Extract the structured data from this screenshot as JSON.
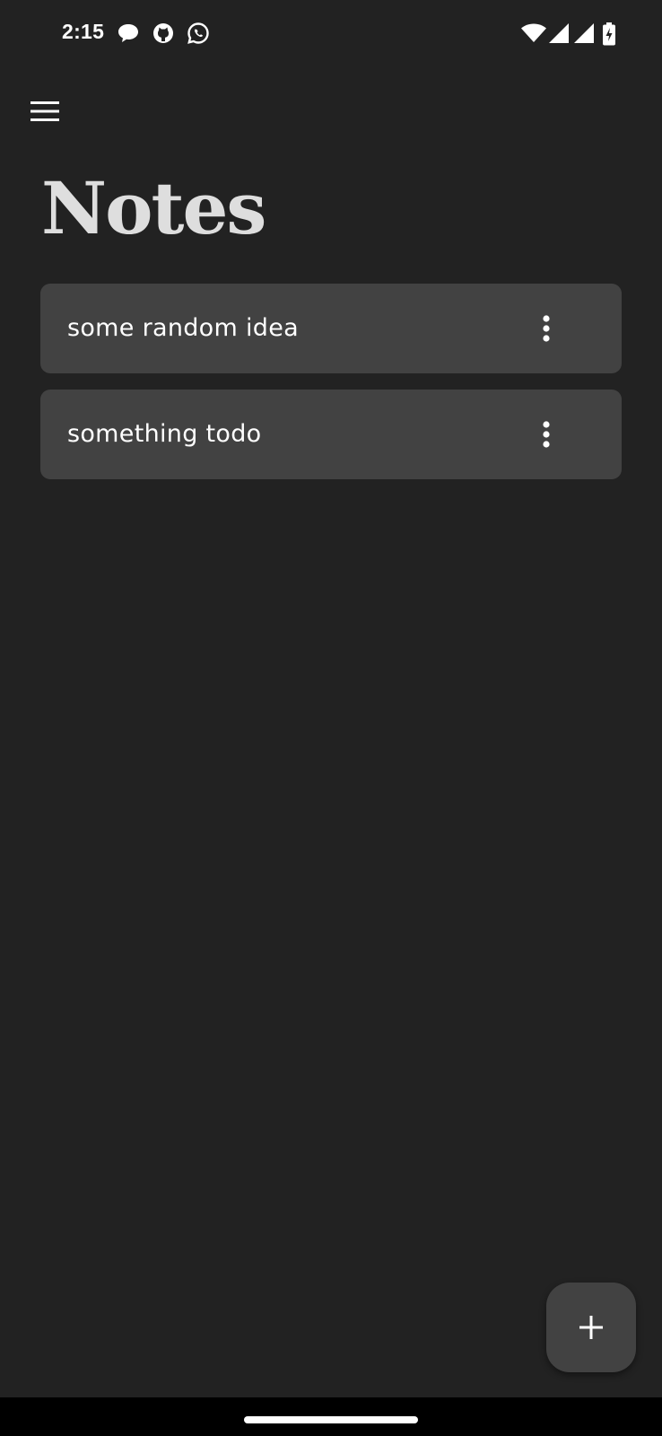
{
  "status_bar": {
    "time": "2:15",
    "notification_icons": [
      "chat-bubble-icon",
      "github-icon",
      "whatsapp-icon"
    ],
    "system_icons": [
      "wifi-icon",
      "signal-icon",
      "signal-icon",
      "battery-charging-icon"
    ]
  },
  "app_bar": {
    "menu_icon": "hamburger-menu-icon"
  },
  "page": {
    "title": "Notes"
  },
  "notes": [
    {
      "text": "some random idea",
      "menu_icon": "more-vert-icon"
    },
    {
      "text": "something todo",
      "menu_icon": "more-vert-icon"
    }
  ],
  "fab": {
    "icon": "plus-icon"
  },
  "colors": {
    "background": "#222222",
    "card": "#424242",
    "title": "#dedede",
    "text": "#ffffff",
    "nav_bar": "#000000"
  }
}
